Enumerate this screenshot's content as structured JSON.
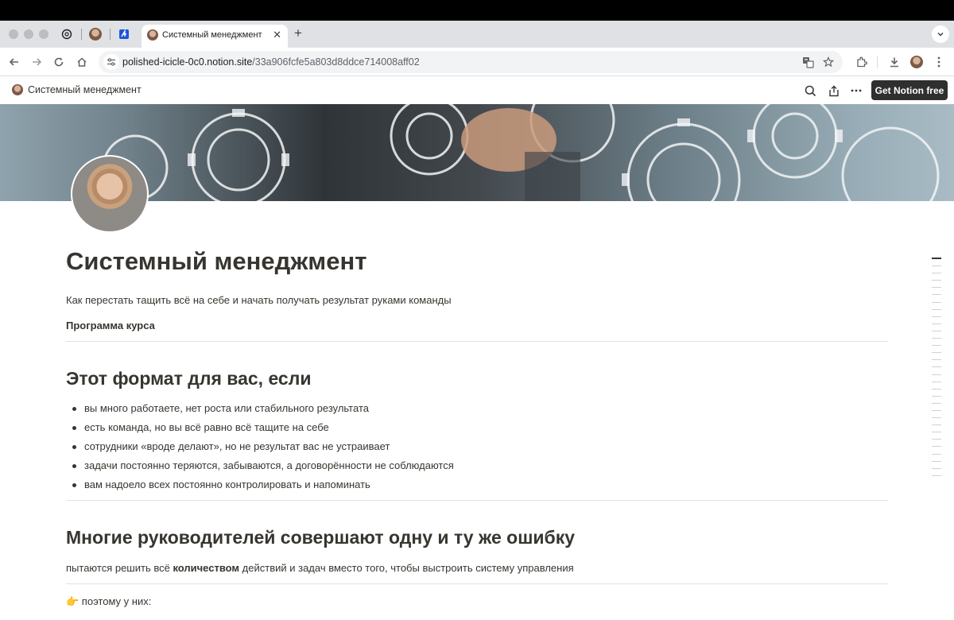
{
  "browser": {
    "tab_title": "Системный менеджмент",
    "url_host": "polished-icicle-0c0.notion.site",
    "url_path": "/33a906fcfe5a803d8ddce714008aff02"
  },
  "notion_bar": {
    "breadcrumb": "Системный менеджмент",
    "cta_label": "Get Notion free"
  },
  "page": {
    "title": "Системный менеджмент",
    "subtitle": "Как перестать тащить всё на себе и начать получать результат руками команды",
    "program_label": "Программа курса",
    "section1_heading": "Этот формат для вас, если",
    "section1_bullets": [
      "вы много работаете, нет роста или стабильного результата",
      "есть команда, но вы всё равно всё тащите на себе",
      "сотрудники «вроде делают», но не результат вас не устраивает",
      "задачи постоянно теряются, забываются, а договорённости не соблюдаются",
      "вам надоело всех постоянно контролировать и напоминать"
    ],
    "section2_heading": "Многие руководителей совершают одну и ту же ошибку",
    "section2_para_before": "пытаются решить всё ",
    "section2_para_bold": "количеством",
    "section2_para_after": " действий и задач вместо того, чтобы выстроить систему управления",
    "pointing_emoji": "👉",
    "pointing_text": " поэтому у них:"
  },
  "icons": {
    "toc": "table-of-contents-ticks",
    "search": "search-icon",
    "share": "share-icon",
    "more": "more-icon"
  }
}
